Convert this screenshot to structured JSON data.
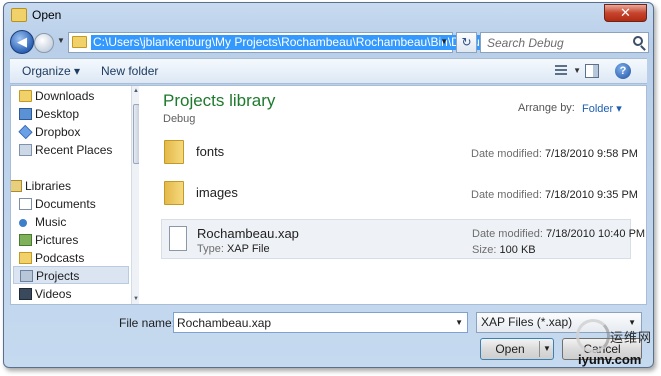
{
  "window": {
    "title": "Open",
    "close_glyph": "✕"
  },
  "address": {
    "path": "C:\\Users\\jblankenburg\\My Projects\\Rochambeau\\Rochambeau\\Bin\\Debug",
    "search_placeholder": "Search Debug"
  },
  "toolbar": {
    "organize": "Organize ▾",
    "new_folder": "New folder"
  },
  "sidebar": {
    "items": [
      {
        "label": "Downloads",
        "icon": "folder-icon"
      },
      {
        "label": "Desktop",
        "icon": "desktop-icon"
      },
      {
        "label": "Dropbox",
        "icon": "dropbox-icon"
      },
      {
        "label": "Recent Places",
        "icon": "recent-places-icon"
      },
      {
        "label": "Libraries",
        "icon": "libraries-icon"
      },
      {
        "label": "Documents",
        "icon": "documents-icon"
      },
      {
        "label": "Music",
        "icon": "music-icon"
      },
      {
        "label": "Pictures",
        "icon": "pictures-icon"
      },
      {
        "label": "Podcasts",
        "icon": "podcasts-icon"
      },
      {
        "label": "Projects",
        "icon": "projects-icon",
        "selected": true
      },
      {
        "label": "Videos",
        "icon": "videos-icon"
      }
    ]
  },
  "content": {
    "library_title": "Projects library",
    "library_subtitle": "Debug",
    "arrange_by_label": "Arrange by:",
    "arrange_by_value": "Folder ▾",
    "files": [
      {
        "name": "fonts",
        "date_label": "Date modified:",
        "date": "7/18/2010 9:58 PM",
        "icon": "folder-icon"
      },
      {
        "name": "images",
        "date_label": "Date modified:",
        "date": "7/18/2010 9:35 PM",
        "icon": "folder-icon"
      },
      {
        "name": "Rochambeau.xap",
        "type_label": "Type:",
        "type": "XAP File",
        "date_label": "Date modified:",
        "date": "7/18/2010 10:40 PM",
        "size_label": "Size:",
        "size": "100 KB",
        "icon": "xap-file-icon",
        "selected": true
      }
    ]
  },
  "footer": {
    "file_name_label": "File name:",
    "file_name_value": "Rochambeau.xap",
    "file_type_value": "XAP Files (*.xap)",
    "open_label": "Open",
    "cancel_label": "Cancel"
  },
  "watermark": {
    "text_cn": "运维网",
    "text_en": "iyunv.com"
  }
}
